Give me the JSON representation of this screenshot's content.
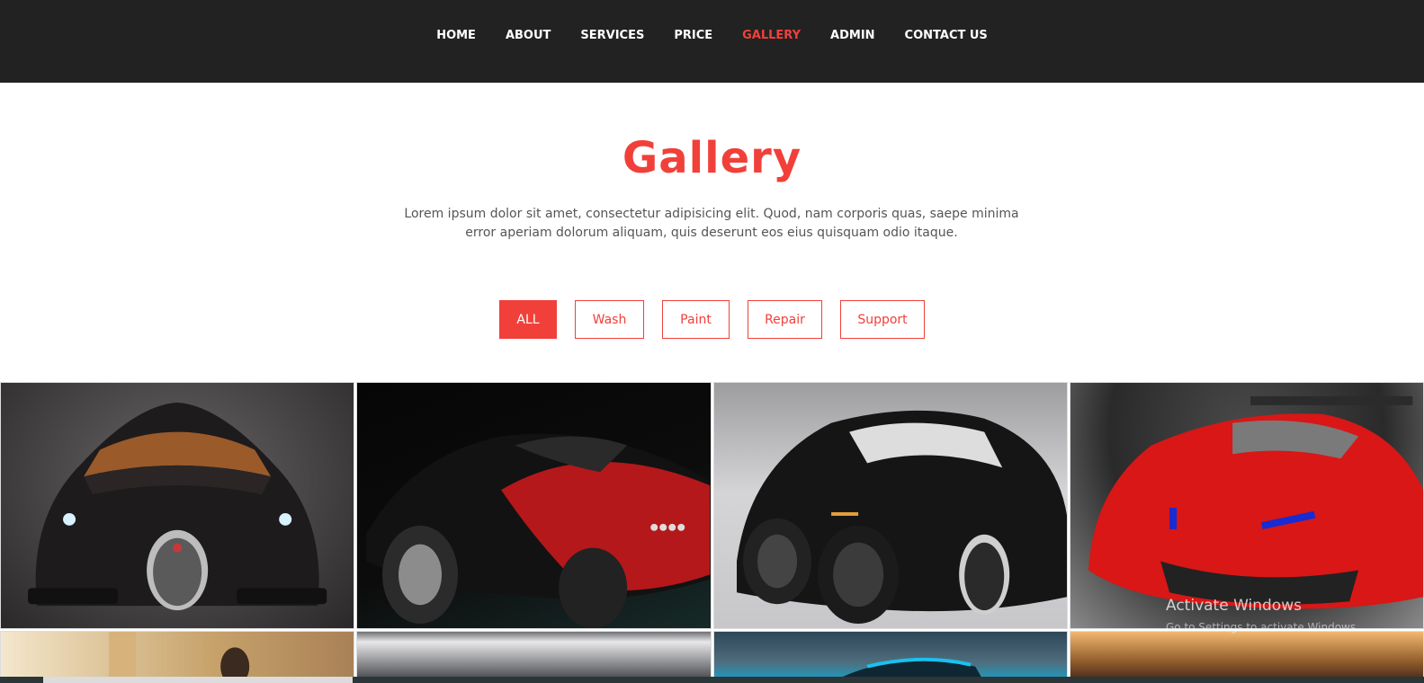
{
  "nav": {
    "items": [
      {
        "label": "HOME"
      },
      {
        "label": "ABOUT"
      },
      {
        "label": "SERVICES"
      },
      {
        "label": "PRICE"
      },
      {
        "label": "GALLERY"
      },
      {
        "label": "ADMIN"
      },
      {
        "label": "CONTACT US"
      }
    ],
    "active_index": 4,
    "background": "#222222",
    "active_color": "#f1403a"
  },
  "section": {
    "title": "Gallery",
    "description": "Lorem ipsum dolor sit amet, consectetur adipisicing elit. Quod, nam corporis quas, saepe minima error aperiam dolorum aliquam, quis deserunt eos eius quisquam odio itaque."
  },
  "filters": {
    "items": [
      {
        "label": "ALL"
      },
      {
        "label": "Wash"
      },
      {
        "label": "Paint"
      },
      {
        "label": "Repair"
      },
      {
        "label": "Support"
      }
    ],
    "active_index": 0,
    "accent": "#f1403a"
  },
  "gallery": {
    "row1": [
      "black supercar front view",
      "red and black coupe rear view",
      "black supercar side view",
      "red sports car front view"
    ],
    "row2": [
      "man in workshop",
      "silver car detail",
      "blue car",
      "garage interior"
    ]
  },
  "watermark": {
    "title": "Activate Windows",
    "subtitle": "Go to Settings to activate Windows."
  }
}
